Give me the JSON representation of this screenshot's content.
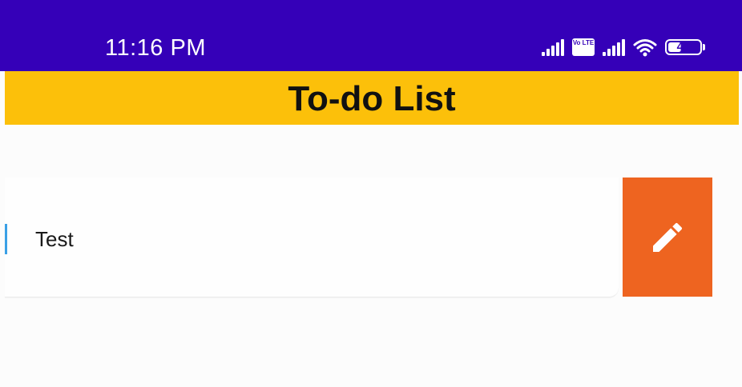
{
  "status_bar": {
    "time": "11:16 PM",
    "volte_label": "Vo LTE",
    "battery_percent": "43",
    "battery_level": 0.43,
    "icons": [
      "signal-icon",
      "volte-icon",
      "signal-icon",
      "wifi-icon",
      "battery-icon"
    ]
  },
  "app_bar": {
    "title": "To-do List"
  },
  "todos": [
    {
      "text": "Test",
      "action_icon": "pencil-icon"
    }
  ],
  "colors": {
    "status_bar": "#3500b8",
    "app_bar": "#fcc00a",
    "edit_action": "#ee6420",
    "accent": "#3aa0e6"
  }
}
